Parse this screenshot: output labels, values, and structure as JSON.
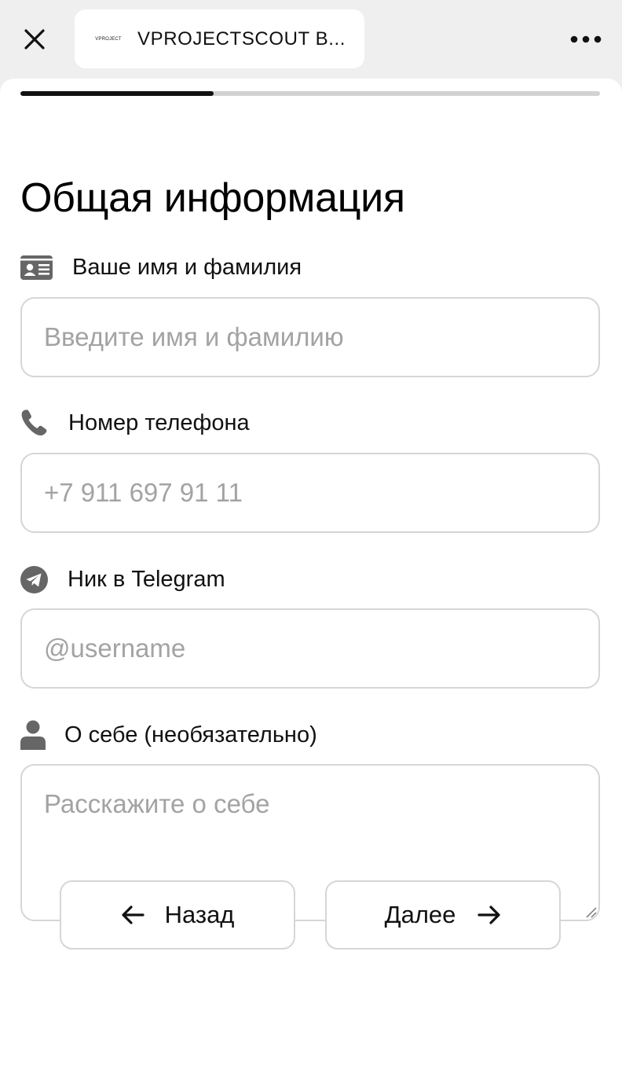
{
  "browser": {
    "title": "VPROJECTSCOUT B...",
    "logo_text": "VPROJECT",
    "close_icon": "close-icon",
    "more_icon": "more-icon"
  },
  "progress": {
    "fraction": 0.333
  },
  "form": {
    "heading": "Общая информация",
    "name": {
      "icon": "id-card-icon",
      "label": "Ваше имя и фамилия",
      "placeholder": "Введите имя и фамилию",
      "value": ""
    },
    "phone": {
      "icon": "phone-icon",
      "label": "Номер телефона",
      "placeholder": "+7 911 697 91 11",
      "value": ""
    },
    "telegram": {
      "icon": "telegram-icon",
      "label": "Ник в Telegram",
      "placeholder": "@username",
      "value": ""
    },
    "about": {
      "icon": "user-icon",
      "label": "О себе (необязательно)",
      "placeholder": "Расскажите о себе",
      "value": ""
    }
  },
  "buttons": {
    "back": {
      "label": "Назад",
      "icon": "arrow-left-icon"
    },
    "next": {
      "label": "Далее",
      "icon": "arrow-right-icon"
    }
  },
  "colors": {
    "accent": "#111111",
    "progress_track": "#d2d2d2",
    "border": "#d6d6d6",
    "placeholder": "#a3a3a3",
    "icon_gray": "#666666",
    "topbar_bg": "#efeff0"
  }
}
